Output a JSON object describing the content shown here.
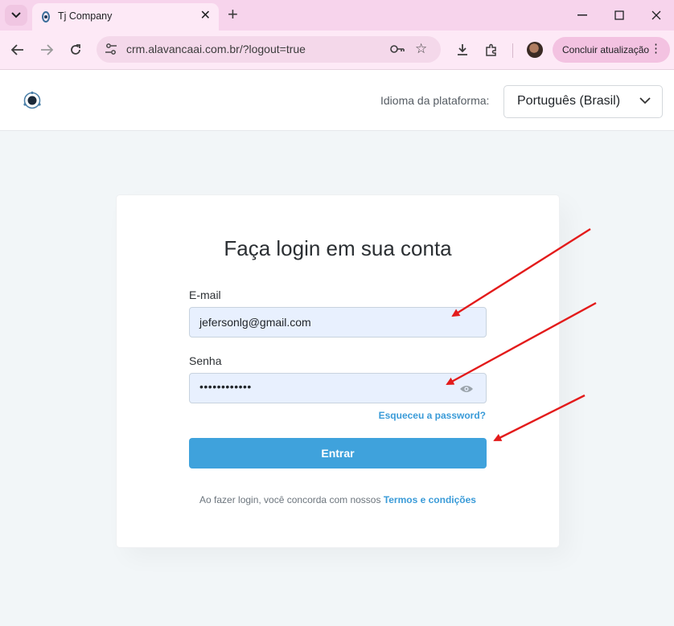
{
  "browser": {
    "tab_title": "Tj Company",
    "url": "crm.alavancaai.com.br/?logout=true",
    "update_button": "Concluir atualização",
    "icons": [
      "tab-search-icon",
      "favicon-icon",
      "close-icon",
      "plus-icon",
      "minimize-icon",
      "maximize-icon",
      "window-close-icon",
      "back-icon",
      "forward-icon",
      "reload-icon",
      "site-settings-icon",
      "key-icon",
      "star-icon",
      "download-icon",
      "extensions-icon",
      "more-icon"
    ]
  },
  "header": {
    "language_label": "Idioma da plataforma:",
    "language_value": "Português (Brasil)"
  },
  "login": {
    "title": "Faça login em sua conta",
    "email_label": "E-mail",
    "email_value": "jefersonlg@gmail.com",
    "password_label": "Senha",
    "password_value": "••••••••••••",
    "forgot_link": "Esqueceu a password?",
    "submit_label": "Entrar",
    "terms_text": "Ao fazer login, você concorda com nossos",
    "terms_link": "Termos e condições"
  },
  "colors": {
    "accent": "#3fa2dc",
    "link": "#3a9bd8",
    "annotation_arrow": "#e31b1b",
    "tabbar": "#f7d4ec",
    "input_bg": "#e8f0fe"
  }
}
